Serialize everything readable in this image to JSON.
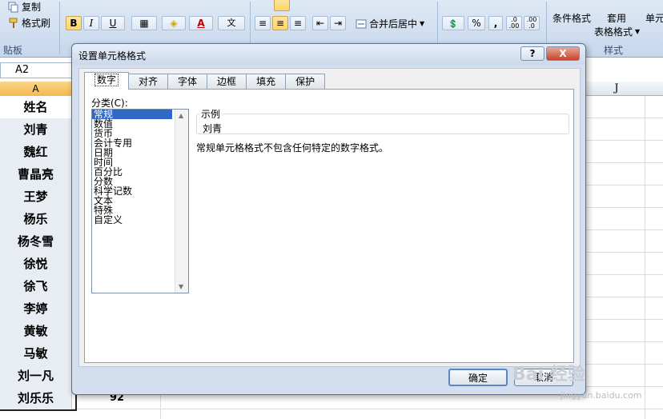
{
  "ribbon": {
    "copy_label": "复制",
    "format_painter_label": "格式刷",
    "clipboard_group": "贴板",
    "bold": "B",
    "italic": "I",
    "underline": "U",
    "font_color_glyph": "A",
    "phonetic_glyph": "文",
    "merge_center_label": "合并后居中",
    "percent": "%",
    "comma": ",",
    "conditional_format_label": "条件格式",
    "table_format_top": "套用",
    "table_format_bottom": "表格格式",
    "cell_styles_top": "单元",
    "styles_group": "样式"
  },
  "namebox": {
    "value": "A2"
  },
  "columns": {
    "a": "A",
    "j": "J"
  },
  "rows": [
    {
      "a": "姓名",
      "b": ""
    },
    {
      "a": "刘青",
      "b": ""
    },
    {
      "a": "魏红",
      "b": ""
    },
    {
      "a": "曹晶亮",
      "b": ""
    },
    {
      "a": "王梦",
      "b": ""
    },
    {
      "a": "杨乐",
      "b": ""
    },
    {
      "a": "杨冬雪",
      "b": ""
    },
    {
      "a": "徐悦",
      "b": ""
    },
    {
      "a": "徐飞",
      "b": ""
    },
    {
      "a": "李婷",
      "b": ""
    },
    {
      "a": "黄敏",
      "b": ""
    },
    {
      "a": "马敏",
      "b": ""
    },
    {
      "a": "刘一凡",
      "b": ""
    },
    {
      "a": "刘乐乐",
      "b": "92"
    }
  ],
  "dialog": {
    "title": "设置单元格格式",
    "help": "?",
    "close": "X",
    "tabs": [
      {
        "label": "数字",
        "active": true
      },
      {
        "label": "对齐",
        "active": false
      },
      {
        "label": "字体",
        "active": false
      },
      {
        "label": "边框",
        "active": false
      },
      {
        "label": "填充",
        "active": false
      },
      {
        "label": "保护",
        "active": false
      }
    ],
    "category_label": "分类(C):",
    "categories": [
      "常规",
      "数值",
      "货币",
      "会计专用",
      "日期",
      "时间",
      "百分比",
      "分数",
      "科学记数",
      "文本",
      "特殊",
      "自定义"
    ],
    "selected_category": 0,
    "sample_label": "示例",
    "sample_value": "刘青",
    "description": "常规单元格格式不包含任何特定的数字格式。",
    "ok": "确定",
    "cancel": "取消"
  },
  "watermark": {
    "brand": "Bai 经验",
    "url": "jingyan.baidu.com"
  }
}
